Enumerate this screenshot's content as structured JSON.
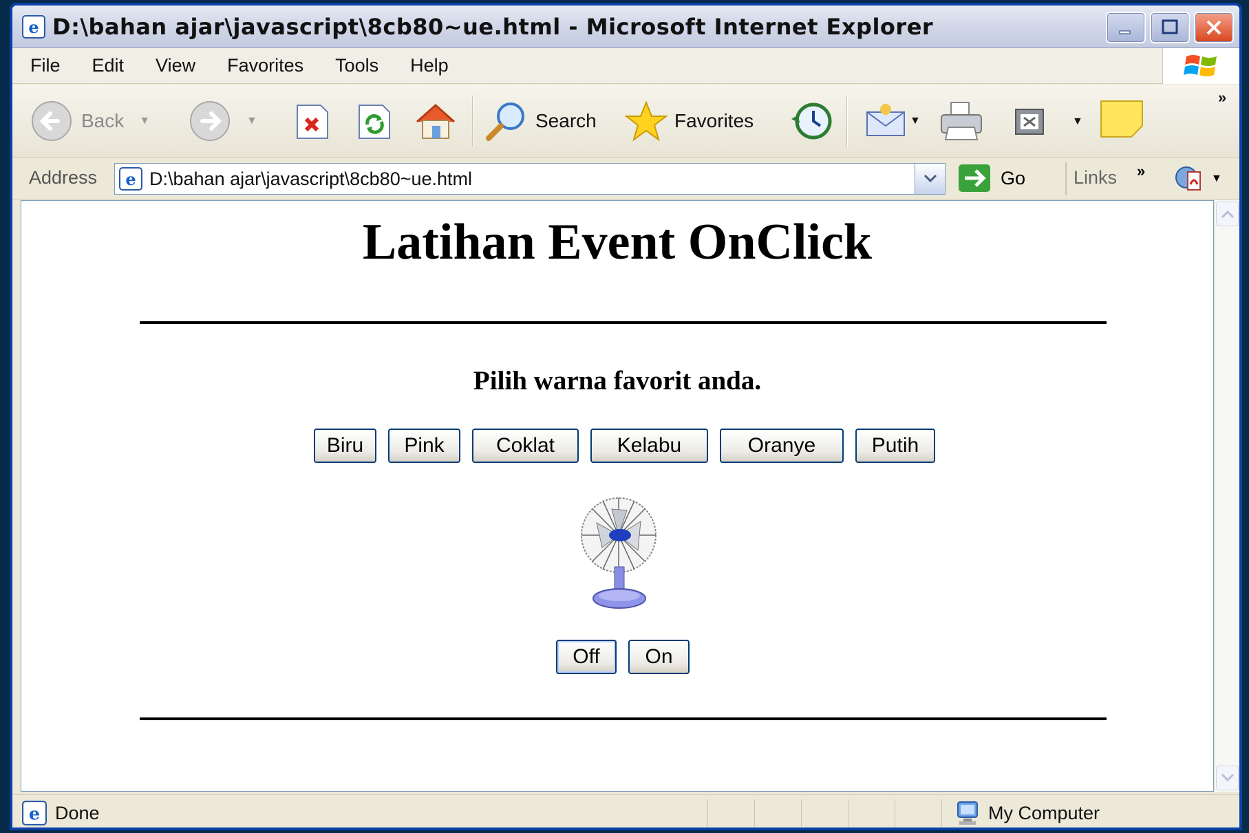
{
  "window": {
    "title": "D:\\bahan ajar\\javascript\\8cb80~ue.html - Microsoft Internet Explorer"
  },
  "menu": [
    "File",
    "Edit",
    "View",
    "Favorites",
    "Tools",
    "Help"
  ],
  "toolbar": {
    "back_label": "Back",
    "search_label": "Search",
    "favorites_label": "Favorites"
  },
  "address": {
    "label": "Address",
    "value": "D:\\bahan ajar\\javascript\\8cb80~ue.html",
    "go_label": "Go",
    "links_label": "Links"
  },
  "page": {
    "title": "Latihan Event OnClick",
    "subtitle": "Pilih warna favorit anda.",
    "color_buttons": [
      "Biru",
      "Pink",
      "Coklat",
      "Kelabu",
      "Oranye",
      "Putih"
    ],
    "off_label": "Off",
    "on_label": "On"
  },
  "status": {
    "text": "Done",
    "zone": "My Computer"
  },
  "colors": {
    "accent": "#0a3fa8",
    "button_border": "#003c74"
  }
}
